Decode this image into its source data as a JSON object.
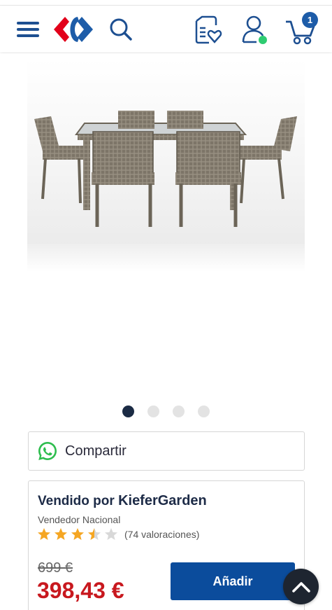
{
  "header": {
    "menu_icon": "hamburger-menu-icon",
    "logo": "carrefour-logo",
    "search_icon": "search-icon",
    "lists_icon": "shopping-list-heart-icon",
    "account_icon": "user-account-icon",
    "cart_icon": "shopping-cart-icon",
    "cart_count": "1",
    "colors": {
      "brand_blue": "#1d5ca8",
      "brand_red": "#e2001a",
      "online_dot": "#2ecc71"
    }
  },
  "gallery": {
    "image_subject": "rattan-garden-dining-set",
    "total_slides": 4,
    "active_slide": 1
  },
  "share": {
    "label": "Compartir",
    "icon": "whatsapp-icon"
  },
  "seller": {
    "sold_by_prefix": "Vendido por",
    "seller_name": "KieferGarden",
    "seller_type": "Vendedor Nacional",
    "rating_value": 3.5,
    "rating_max": 5,
    "rating_count_text": "(74 valoraciones)"
  },
  "pricing": {
    "old_price": "699 €",
    "price": "398,43 €",
    "add_button_label": "Añadir",
    "price_color": "#c8181e",
    "button_color": "#0b4c9c"
  },
  "scroll_top_icon": "chevron-up-icon"
}
